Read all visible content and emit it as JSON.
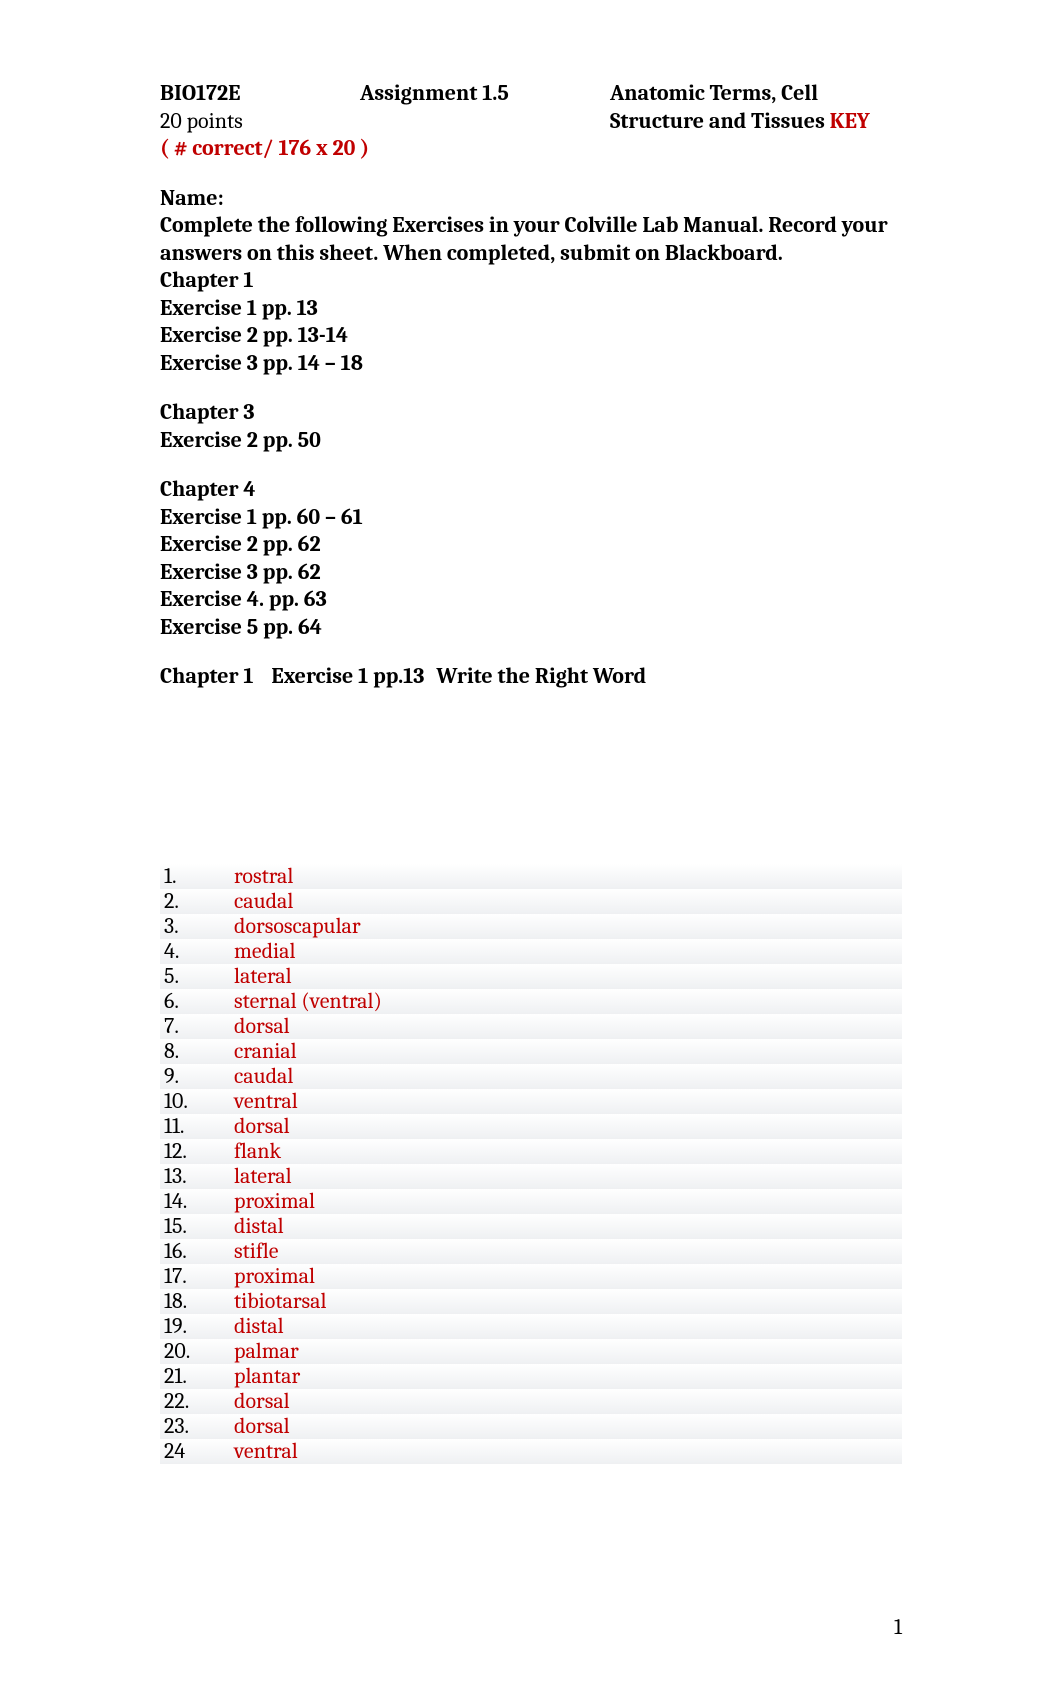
{
  "header": {
    "course": "BIO172E",
    "assignment": "Assignment 1.5",
    "topic_line1": "Anatomic Terms, Cell",
    "points": "20 points",
    "topic_line2_pre": "Structure and Tissues ",
    "topic_line2_key": "KEY",
    "formula": "( # correct/ 176  x 20 )"
  },
  "intro": {
    "name_label": "Name:",
    "line1": "Complete the following Exercises in your Colville Lab Manual.  Record your",
    "line2": "answers on this sheet.  When completed, submit on Blackboard.",
    "ch1_title": "Chapter 1",
    "ch1_ex1": "Exercise 1 pp. 13",
    "ch1_ex2": "Exercise 2 pp. 13-14",
    "ch1_ex3": "Exercise 3 pp. 14 – 18",
    "ch3_title": "Chapter 3",
    "ch3_ex2": "Exercise 2 pp. 50",
    "ch4_title": "Chapter 4",
    "ch4_ex1": "Exercise 1 pp. 60 – 61",
    "ch4_ex2": "Exercise 2 pp. 62",
    "ch4_ex3": "Exercise 3 pp. 62",
    "ch4_ex4": "Exercise 4. pp. 63",
    "ch4_ex5": "Exercise 5 pp. 64"
  },
  "exercise_heading": {
    "chapter": "Chapter 1",
    "exercise": "Exercise 1 pp.13",
    "title": "Write the Right Word"
  },
  "answers": [
    {
      "num": "1.",
      "val": "rostral"
    },
    {
      "num": "2.",
      "val": "caudal"
    },
    {
      "num": "3.",
      "val": "dorsoscapular"
    },
    {
      "num": "4.",
      "val": "medial"
    },
    {
      "num": "5.",
      "val": "lateral"
    },
    {
      "num": "6.",
      "val": "sternal (ventral)"
    },
    {
      "num": "7.",
      "val": "dorsal"
    },
    {
      "num": "8.",
      "val": "cranial"
    },
    {
      "num": "9.",
      "val": "caudal"
    },
    {
      "num": "10.",
      "val": "ventral"
    },
    {
      "num": "11.",
      "val": "dorsal"
    },
    {
      "num": "12.",
      "val": "flank"
    },
    {
      "num": "13.",
      "val": "lateral"
    },
    {
      "num": "14.",
      "val": "proximal"
    },
    {
      "num": "15.",
      "val": "distal"
    },
    {
      "num": "16.",
      "val": "stifle"
    },
    {
      "num": "17.",
      "val": "proximal"
    },
    {
      "num": "18.",
      "val": "tibiotarsal"
    },
    {
      "num": "19.",
      "val": "distal"
    },
    {
      "num": "20.",
      "val": "palmar"
    },
    {
      "num": "21.",
      "val": "plantar"
    },
    {
      "num": "22.",
      "val": "dorsal"
    },
    {
      "num": "23.",
      "val": "dorsal"
    },
    {
      "num": "24",
      "val": "ventral"
    }
  ],
  "page_number": "1"
}
